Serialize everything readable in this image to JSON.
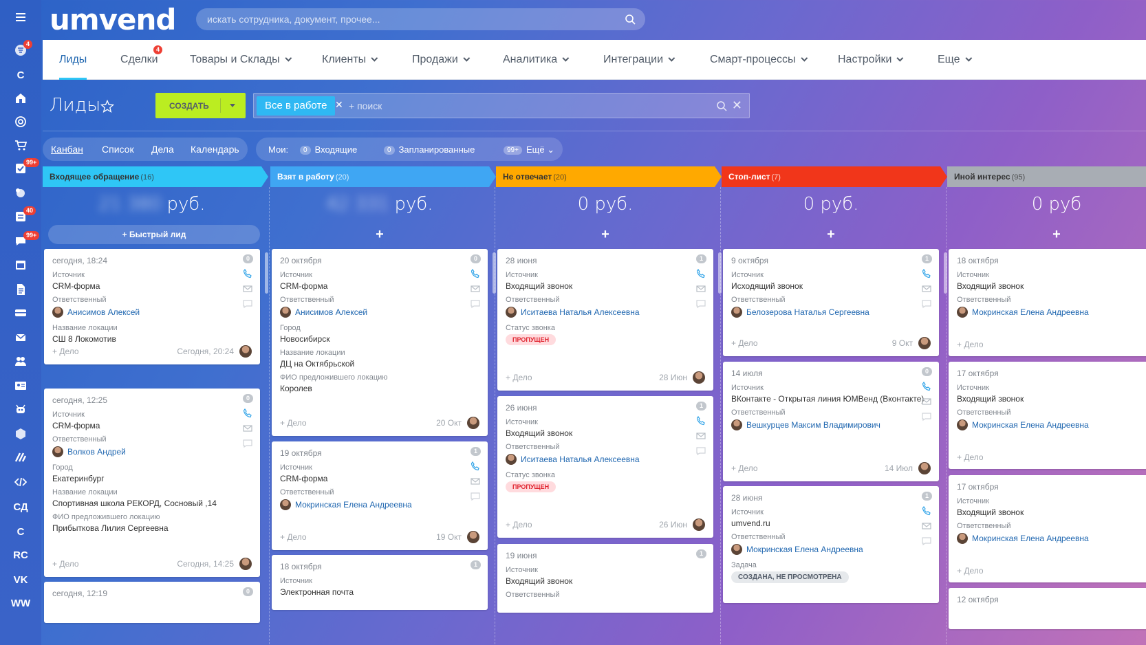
{
  "app": {
    "logo": "umvend",
    "search_placeholder": "искать сотрудника, документ, прочее..."
  },
  "sidebar": {
    "items": [
      {
        "icon": "menu-icon"
      },
      {
        "icon": "filter-icon",
        "badge": "4"
      },
      {
        "icon": "text",
        "label": "С"
      },
      {
        "icon": "home-icon"
      },
      {
        "icon": "target-icon"
      },
      {
        "icon": "cart-icon"
      },
      {
        "icon": "tasks-icon",
        "badge": "99+"
      },
      {
        "icon": "crm-icon"
      },
      {
        "icon": "feed-icon",
        "badge": "40"
      },
      {
        "icon": "chat-icon",
        "badge": "99+"
      },
      {
        "icon": "calendar-icon"
      },
      {
        "icon": "document-icon"
      },
      {
        "icon": "drive-icon"
      },
      {
        "icon": "mail-icon"
      },
      {
        "icon": "people-icon"
      },
      {
        "icon": "contact-card-icon"
      },
      {
        "icon": "robot-icon"
      },
      {
        "icon": "box-icon"
      },
      {
        "icon": "brand-icon"
      },
      {
        "icon": "code-icon"
      },
      {
        "icon": "text",
        "label": "СД"
      },
      {
        "icon": "text",
        "label": "С"
      },
      {
        "icon": "text",
        "label": "RC"
      },
      {
        "icon": "text",
        "label": "VK"
      },
      {
        "icon": "text",
        "label": "WW"
      }
    ]
  },
  "menu": {
    "items": [
      {
        "label": "Лиды",
        "active": true
      },
      {
        "label": "Сделки",
        "badge": "4"
      },
      {
        "label": "Товары и Склады",
        "dropdown": true
      },
      {
        "label": "Клиенты",
        "dropdown": true
      },
      {
        "label": "Продажи",
        "dropdown": true
      },
      {
        "label": "Аналитика",
        "dropdown": true
      },
      {
        "label": "Интеграции",
        "dropdown": true
      },
      {
        "label": "Смарт-процессы",
        "dropdown": true
      },
      {
        "label": "Настройки",
        "dropdown": true
      },
      {
        "label": "Еще",
        "dropdown": true
      }
    ]
  },
  "page": {
    "title": "Лиды",
    "create_label": "СОЗДАТЬ",
    "filter_chip": "Все в работе",
    "filter_placeholder": "+ поиск"
  },
  "views": {
    "items": [
      "Канбан",
      "Список",
      "Дела",
      "Календарь"
    ],
    "active": "Канбан"
  },
  "my": {
    "label": "Мои:",
    "incoming_count": "0",
    "incoming_label": "Входящие",
    "planned_count": "0",
    "planned_label": "Запланированные",
    "more_count": "99+",
    "more_label": "Ещё"
  },
  "colors": {
    "lime": "#bbed21",
    "chip": "#2fb8f3",
    "link": "#2067b0",
    "missed_bg": "#ffdbde",
    "missed_text": "#e0242f"
  },
  "columns": [
    {
      "title": "Входящее обращение",
      "count": "(16)",
      "color": "#2fc6f6",
      "text_color": "#333",
      "sum_blurred": "21 380",
      "sum_currency": "руб.",
      "quick": "+ Быстрый лид",
      "cards": [
        {
          "date": "сегодня, 18:24",
          "count": "0",
          "fields": [
            [
              "Источник",
              "CRM-форма"
            ]
          ],
          "resp_label": "Ответственный",
          "resp": "Анисимов Алексей",
          "extra": [
            [
              "Название локации",
              "СШ 8 Локомотив"
            ]
          ],
          "deal": "+ Дело",
          "foot_date": "Сегодня, 20:24"
        },
        {
          "date": "сегодня, 12:25",
          "count": "0",
          "fields": [
            [
              "Источник",
              "CRM-форма"
            ]
          ],
          "resp_label": "Ответственный",
          "resp": "Волков Андрей",
          "extra": [
            [
              "Город",
              "Екатеринбург"
            ],
            [
              "Название локации",
              "Спортивная школа РЕКОРД, Сосновый ,14"
            ],
            [
              "ФИО предложившего локацию",
              "Прибыткова Лилия Сергеевна"
            ]
          ],
          "deal": "+ Дело",
          "foot_date": "Сегодня, 14:25"
        },
        {
          "date": "сегодня, 12:19",
          "count": "0"
        }
      ]
    },
    {
      "title": "Взят в работу",
      "count": "(20)",
      "color": "#3fa6f3",
      "text_color": "#fff",
      "sum_blurred": "42 331",
      "sum_currency": "руб.",
      "quick": "+",
      "cards": [
        {
          "date": "20 октября",
          "count": "0",
          "fields": [
            [
              "Источник",
              "CRM-форма"
            ]
          ],
          "resp_label": "Ответственный",
          "resp": "Анисимов Алексей",
          "extra": [
            [
              "Город",
              "Новосибирск"
            ],
            [
              "Название локации",
              "ДЦ на Октябрьской"
            ],
            [
              "ФИО предложившего локацию",
              "Королев"
            ]
          ],
          "deal": "+ Дело",
          "foot_date": "20 Окт"
        },
        {
          "date": "19 октября",
          "count": "1",
          "fields": [
            [
              "Источник",
              "CRM-форма"
            ]
          ],
          "resp_label": "Ответственный",
          "resp": "Мокринская Елена Андреевна",
          "extra": [],
          "deal": "+ Дело",
          "foot_date": "19 Окт"
        },
        {
          "date": "18 октября",
          "count": "1",
          "fields": [
            [
              "Источник",
              "Электронная почта"
            ]
          ]
        }
      ]
    },
    {
      "title": "Не отвечает",
      "count": "(20)",
      "color": "#ffa900",
      "text_color": "#333",
      "sum_text": "0 руб.",
      "quick": "+",
      "cards": [
        {
          "date": "28 июня",
          "count": "1",
          "fields": [
            [
              "Источник",
              "Входящий звонок"
            ]
          ],
          "resp_label": "Ответственный",
          "resp": "Иситаева Наталья Алексеевна",
          "status_label": "Статус звонка",
          "status": "ПРОПУЩЕН",
          "deal": "+ Дело",
          "foot_date": "28 Июн"
        },
        {
          "date": "26 июня",
          "count": "1",
          "fields": [
            [
              "Источник",
              "Входящий звонок"
            ]
          ],
          "resp_label": "Ответственный",
          "resp": "Иситаева Наталья Алексеевна",
          "status_label": "Статус звонка",
          "status": "ПРОПУЩЕН",
          "deal": "+ Дело",
          "foot_date": "26 Июн"
        },
        {
          "date": "19 июня",
          "count": "1",
          "fields": [
            [
              "Источник",
              "Входящий звонок"
            ]
          ],
          "resp_label": "Ответственный"
        }
      ]
    },
    {
      "title": "Стоп-лист",
      "count": "(7)",
      "color": "#f1361a",
      "text_color": "#fff",
      "sum_text": "0 руб.",
      "quick": "+",
      "cards": [
        {
          "date": "9 октября",
          "count": "1",
          "fields": [
            [
              "Источник",
              "Исходящий звонок"
            ]
          ],
          "resp_label": "Ответственный",
          "resp": "Белозерова Наталья Сергеевна",
          "deal": "+ Дело",
          "foot_date": "9 Окт"
        },
        {
          "date": "14 июля",
          "count": "0",
          "fields": [
            [
              "Источник",
              "ВКонтакте - Открытая линия ЮМВенд (Вконтакте)"
            ]
          ],
          "resp_label": "Ответственный",
          "resp": "Вешкурцев Максим Владимирович",
          "deal": "+ Дело",
          "foot_date": "14 Июл"
        },
        {
          "date": "28 июня",
          "count": "1",
          "fields": [
            [
              "Источник",
              "umvend.ru"
            ]
          ],
          "resp_label": "Ответственный",
          "resp": "Мокринская Елена Андреевна",
          "task_label": "Задача",
          "task": "СОЗДАНА, НЕ ПРОСМОТРЕНА"
        }
      ]
    },
    {
      "title": "Иной интерес",
      "count": "(95)",
      "color": "#a8adb4",
      "text_color": "#333",
      "sum_text": "0 руб",
      "quick": "+",
      "cards": [
        {
          "date": "18 октября",
          "fields": [
            [
              "Источник",
              "Входящий звонок"
            ]
          ],
          "resp_label": "Ответственный",
          "resp": "Мокринская Елена Андреевна",
          "deal": "+ Дело"
        },
        {
          "date": "17 октября",
          "fields": [
            [
              "Источник",
              "Входящий звонок"
            ]
          ],
          "resp_label": "Ответственный",
          "resp": "Мокринская Елена Андреевна",
          "deal": "+ Дело"
        },
        {
          "date": "17 октября",
          "fields": [
            [
              "Источник",
              "Входящий звонок"
            ]
          ],
          "resp_label": "Ответственный",
          "resp": "Мокринская Елена Андреевна",
          "deal": "+ Дело"
        },
        {
          "date": "12 октября"
        }
      ]
    }
  ]
}
